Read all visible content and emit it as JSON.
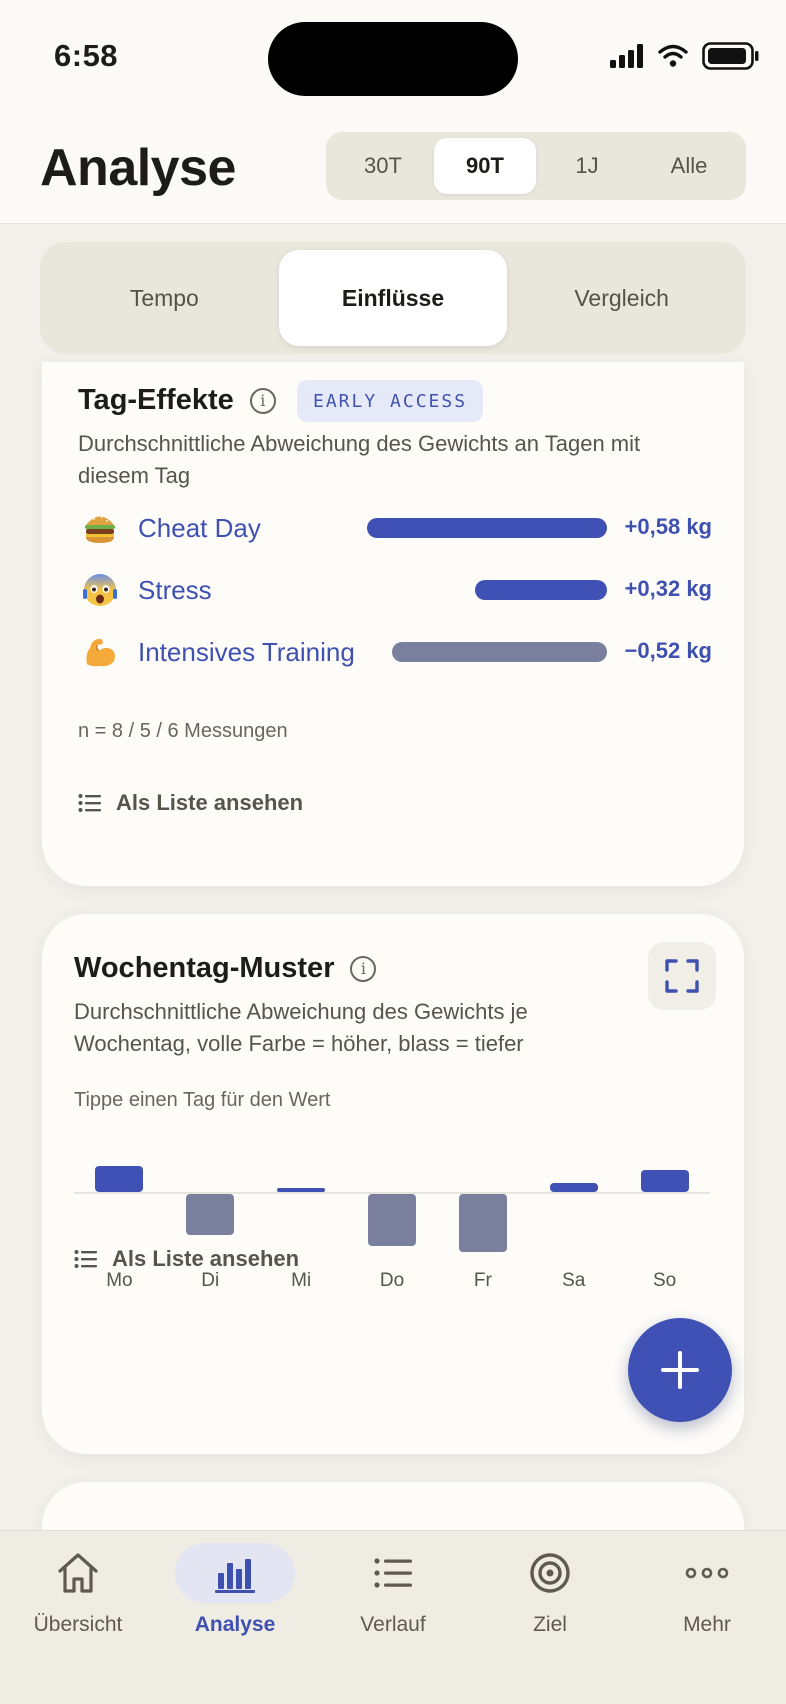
{
  "status_bar": {
    "time": "6:58"
  },
  "header": {
    "title": "Analyse",
    "ranges": [
      {
        "label": "30T",
        "active": false
      },
      {
        "label": "90T",
        "active": true
      },
      {
        "label": "1J",
        "active": false
      },
      {
        "label": "Alle",
        "active": false
      }
    ]
  },
  "tabs": [
    {
      "label": "Tempo",
      "active": false
    },
    {
      "label": "Einflüsse",
      "active": true
    },
    {
      "label": "Vergleich",
      "active": false
    }
  ],
  "tag_effects": {
    "title": "Tag-Effekte",
    "badge": "EARLY ACCESS",
    "description": "Durchschnittliche Abweichung des Gewichts an Tagen mit diesem Tag",
    "effects": [
      {
        "icon": "burger-icon",
        "label": "Cheat Day",
        "value_kg": 0.58,
        "value_text": "+0,58 kg",
        "color": "#3f51b5"
      },
      {
        "icon": "fearful-face-icon",
        "label": "Stress",
        "value_kg": 0.32,
        "value_text": "+0,32 kg",
        "color": "#3f51b5"
      },
      {
        "icon": "flexed-biceps-icon",
        "label": "Intensives Training",
        "value_kg": -0.52,
        "value_text": "−0,52 kg",
        "color": "#7b7f9e"
      }
    ],
    "sample_note": "n = 8 / 5 / 6 Messungen",
    "list_link": "Als Liste ansehen"
  },
  "weekday_pattern": {
    "title": "Wochentag-Muster",
    "description": "Durchschnittliche Abweichung des Gewichts je Wochentag, volle Farbe = höher, blass = tiefer",
    "hint": "Tippe einen Tag für den Wert",
    "list_link": "Als Liste ansehen",
    "colors": {
      "higher": "#3f51b5",
      "lower": "#7b7f9e"
    }
  },
  "chart_data": {
    "type": "bar",
    "categories": [
      "Mo",
      "Di",
      "Mi",
      "Do",
      "Fr",
      "Sa",
      "So"
    ],
    "values": [
      0.45,
      -0.7,
      0.05,
      -0.9,
      -1.0,
      0.15,
      0.38
    ],
    "title": "Wochentag-Muster",
    "xlabel": "",
    "ylabel": "",
    "ylim": [
      -1.0,
      1.0
    ],
    "grid": false
  },
  "fab": {
    "icon": "plus-icon"
  },
  "bottom_nav": [
    {
      "label": "Übersicht",
      "icon": "home-icon",
      "active": false
    },
    {
      "label": "Analyse",
      "icon": "bar-chart-icon",
      "active": true
    },
    {
      "label": "Verlauf",
      "icon": "list-icon",
      "active": false
    },
    {
      "label": "Ziel",
      "icon": "target-icon",
      "active": false
    },
    {
      "label": "Mehr",
      "icon": "more-icon",
      "active": false
    }
  ]
}
